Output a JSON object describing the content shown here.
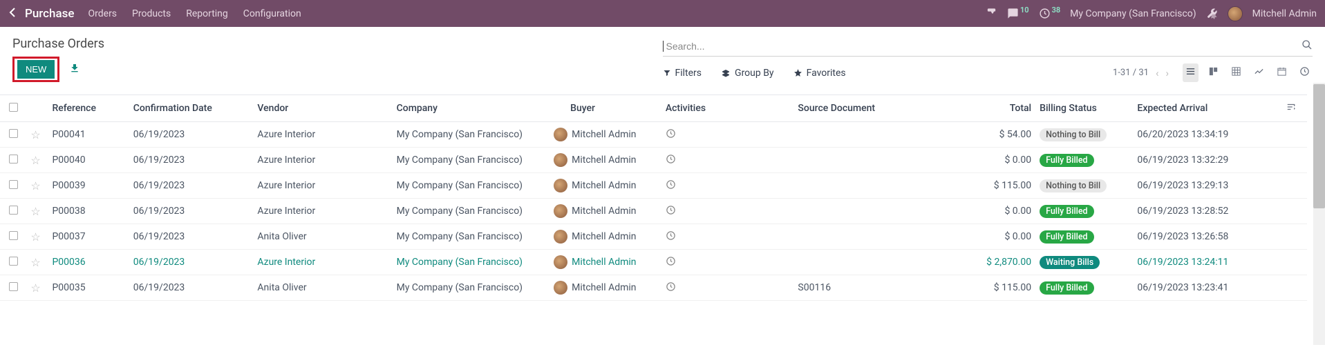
{
  "topbar": {
    "brand": "Purchase",
    "menu": [
      "Orders",
      "Products",
      "Reporting",
      "Configuration"
    ],
    "discuss_badge": "10",
    "activity_badge": "38",
    "company": "My Company (San Francisco)",
    "user": "Mitchell Admin"
  },
  "header": {
    "title": "Purchase Orders",
    "new_btn": "NEW"
  },
  "search": {
    "placeholder": "Search..."
  },
  "toolbar": {
    "filters": "Filters",
    "groupby": "Group By",
    "favorites": "Favorites",
    "pager": "1-31 / 31"
  },
  "columns": {
    "reference": "Reference",
    "confirmation": "Confirmation Date",
    "vendor": "Vendor",
    "company": "Company",
    "buyer": "Buyer",
    "activities": "Activities",
    "source": "Source Document",
    "total": "Total",
    "billing": "Billing Status",
    "arrival": "Expected Arrival"
  },
  "rows": [
    {
      "ref": "P00041",
      "date": "06/19/2023",
      "vendor": "Azure Interior",
      "company": "My Company (San Francisco)",
      "buyer": "Mitchell Admin",
      "src": "",
      "total": "$ 54.00",
      "billing": "Nothing to Bill",
      "billing_class": "pill-gray",
      "arrival": "06/20/2023 13:34:19",
      "hover": false
    },
    {
      "ref": "P00040",
      "date": "06/19/2023",
      "vendor": "Azure Interior",
      "company": "My Company (San Francisco)",
      "buyer": "Mitchell Admin",
      "src": "",
      "total": "$ 0.00",
      "billing": "Fully Billed",
      "billing_class": "pill-green",
      "arrival": "06/19/2023 13:32:29",
      "hover": false
    },
    {
      "ref": "P00039",
      "date": "06/19/2023",
      "vendor": "Azure Interior",
      "company": "My Company (San Francisco)",
      "buyer": "Mitchell Admin",
      "src": "",
      "total": "$ 115.00",
      "billing": "Nothing to Bill",
      "billing_class": "pill-gray",
      "arrival": "06/19/2023 13:29:13",
      "hover": false
    },
    {
      "ref": "P00038",
      "date": "06/19/2023",
      "vendor": "Azure Interior",
      "company": "My Company (San Francisco)",
      "buyer": "Mitchell Admin",
      "src": "",
      "total": "$ 0.00",
      "billing": "Fully Billed",
      "billing_class": "pill-green",
      "arrival": "06/19/2023 13:28:52",
      "hover": false
    },
    {
      "ref": "P00037",
      "date": "06/19/2023",
      "vendor": "Anita Oliver",
      "company": "My Company (San Francisco)",
      "buyer": "Mitchell Admin",
      "src": "",
      "total": "$ 0.00",
      "billing": "Fully Billed",
      "billing_class": "pill-green",
      "arrival": "06/19/2023 13:26:58",
      "hover": false
    },
    {
      "ref": "P00036",
      "date": "06/19/2023",
      "vendor": "Azure Interior",
      "company": "My Company (San Francisco)",
      "buyer": "Mitchell Admin",
      "src": "",
      "total": "$ 2,870.00",
      "billing": "Waiting Bills",
      "billing_class": "pill-teal",
      "arrival": "06/19/2023 13:24:11",
      "hover": true
    },
    {
      "ref": "P00035",
      "date": "06/19/2023",
      "vendor": "Anita Oliver",
      "company": "My Company (San Francisco)",
      "buyer": "Mitchell Admin",
      "src": "S00116",
      "total": "$ 115.00",
      "billing": "Fully Billed",
      "billing_class": "pill-green",
      "arrival": "06/19/2023 13:23:41",
      "hover": false
    }
  ]
}
